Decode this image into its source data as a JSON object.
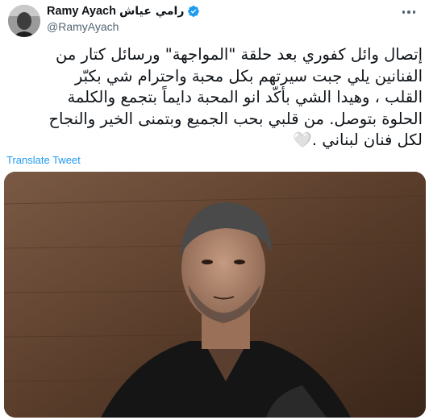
{
  "user": {
    "display_name": "Ramy Ayach",
    "arabic_name": "رامي عياش",
    "handle": "@RamyAyach",
    "verified": true
  },
  "tweet": {
    "text": "إتصال وائل كفوري بعد حلقة \"المواجهة\" ورسائل كتار من\nالفنانين يلي جبت سيرتهم بكل محبة واحترام شي بكبّر\nالقلب ، وهيدا الشي بأكّد انو المحبة دايماً بتجمع والكلمة\nالحلوة بتوصل. من قلبي بحب الجميع وبتمنى الخير والنجاح\nلكل فنان لبناني .",
    "emoji": "🤍",
    "translate_label": "Translate Tweet"
  },
  "icons": {
    "verified": "verified-badge-icon",
    "more": "more-options-icon"
  },
  "colors": {
    "link": "#1d9bf0",
    "secondary_text": "#536471",
    "primary_text": "#0f1419"
  }
}
